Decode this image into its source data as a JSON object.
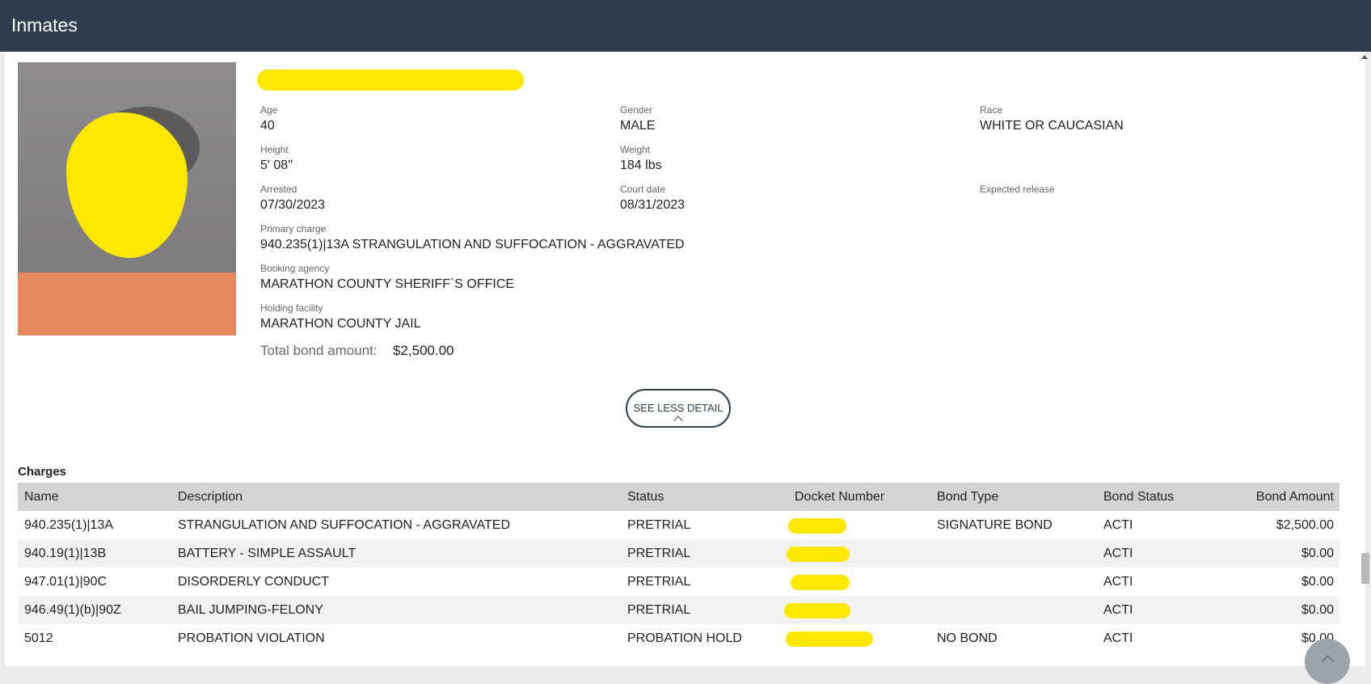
{
  "app": {
    "title": "Inmates"
  },
  "inmate": {
    "fields": {
      "age": {
        "label": "Age",
        "value": "40"
      },
      "gender": {
        "label": "Gender",
        "value": "MALE"
      },
      "race": {
        "label": "Race",
        "value": "WHITE OR CAUCASIAN"
      },
      "height": {
        "label": "Height",
        "value": "5' 08\""
      },
      "weight": {
        "label": "Weight",
        "value": "184 lbs"
      },
      "arrested": {
        "label": "Arrested",
        "value": "07/30/2023"
      },
      "court_date": {
        "label": "Court date",
        "value": "08/31/2023"
      },
      "expected_release": {
        "label": "Expected release",
        "value": ""
      },
      "primary_charge": {
        "label": "Primary charge",
        "value": "940.235(1)|13A STRANGULATION AND SUFFOCATION - AGGRAVATED"
      },
      "booking_agency": {
        "label": "Booking agency",
        "value": "MARATHON COUNTY SHERIFF`S OFFICE"
      },
      "holding_facility": {
        "label": "Holding facility",
        "value": "MARATHON COUNTY JAIL"
      }
    },
    "bond": {
      "label": "Total bond amount:",
      "value": "$2,500.00"
    }
  },
  "see_less_label": "SEE LESS DETAIL",
  "charges": {
    "heading": "Charges",
    "columns": {
      "name": "Name",
      "description": "Description",
      "status": "Status",
      "docket": "Docket Number",
      "bond_type": "Bond Type",
      "bond_status": "Bond Status",
      "bond_amount": "Bond Amount"
    },
    "rows": [
      {
        "name": "940.235(1)|13A",
        "description": "STRANGULATION AND SUFFOCATION - AGGRAVATED",
        "status": "PRETRIAL",
        "bond_type": "SIGNATURE BOND",
        "bond_status": "ACTI",
        "bond_amount": "$2,500.00"
      },
      {
        "name": "940.19(1)|13B",
        "description": "BATTERY - SIMPLE ASSAULT",
        "status": "PRETRIAL",
        "bond_type": "",
        "bond_status": "ACTI",
        "bond_amount": "$0.00"
      },
      {
        "name": "947.01(1)|90C",
        "description": "DISORDERLY CONDUCT",
        "status": "PRETRIAL",
        "bond_type": "",
        "bond_status": "ACTI",
        "bond_amount": "$0.00"
      },
      {
        "name": "946.49(1)(b)|90Z",
        "description": "BAIL JUMPING-FELONY",
        "status": "PRETRIAL",
        "bond_type": "",
        "bond_status": "ACTI",
        "bond_amount": "$0.00"
      },
      {
        "name": "5012",
        "description": "PROBATION VIOLATION",
        "status": "PROBATION HOLD",
        "bond_type": "NO BOND",
        "bond_status": "ACTI",
        "bond_amount": "$0.00"
      }
    ]
  },
  "colors": {
    "header_bg": "#2e3e4f",
    "redaction": "#fde800",
    "table_header_bg": "#d4d4d4",
    "row_alt_bg": "#f2f2f2"
  }
}
